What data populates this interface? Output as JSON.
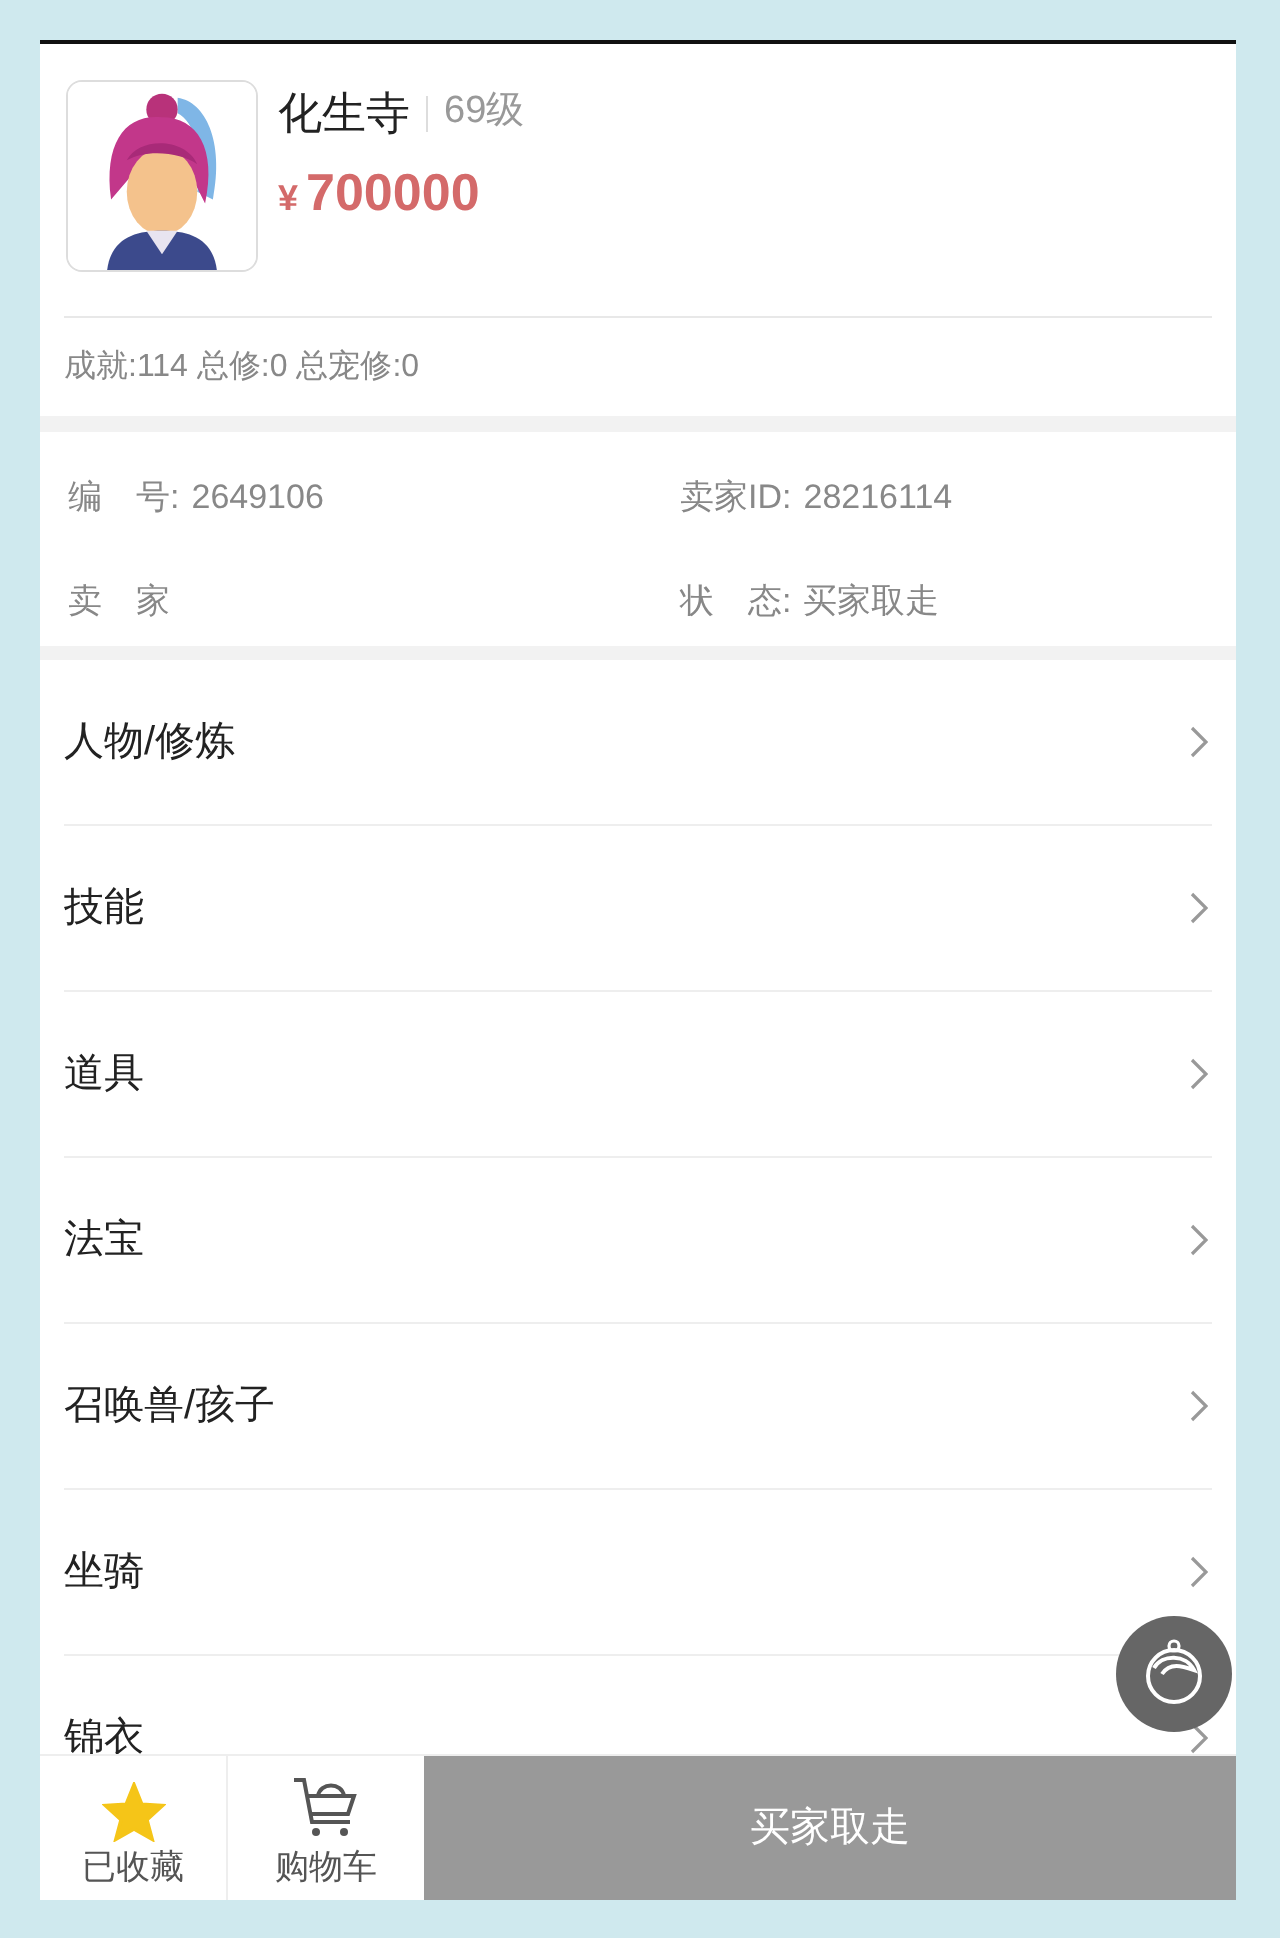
{
  "character": {
    "school": "化生寺",
    "level": "69级",
    "price_symbol": "¥",
    "price": "700000",
    "stats": "成就:114 总修:0 总宠修:0"
  },
  "info": [
    {
      "label": "编　号:",
      "value": "2649106"
    },
    {
      "label": "卖家ID:",
      "value": "28216114"
    },
    {
      "label": "卖　家"
    },
    {
      "label": "状　态:",
      "value": "买家取走"
    }
  ],
  "menu": [
    {
      "label": "人物/修炼"
    },
    {
      "label": "技能"
    },
    {
      "label": "道具"
    },
    {
      "label": "法宝"
    },
    {
      "label": "召唤兽/孩子"
    },
    {
      "label": "坐骑"
    },
    {
      "label": "锦衣"
    }
  ],
  "bottom_bar": {
    "favorite": {
      "label": "已收藏",
      "selected": true
    },
    "cart": {
      "label": "购物车"
    },
    "action": {
      "label": "买家取走",
      "disabled": true
    }
  }
}
